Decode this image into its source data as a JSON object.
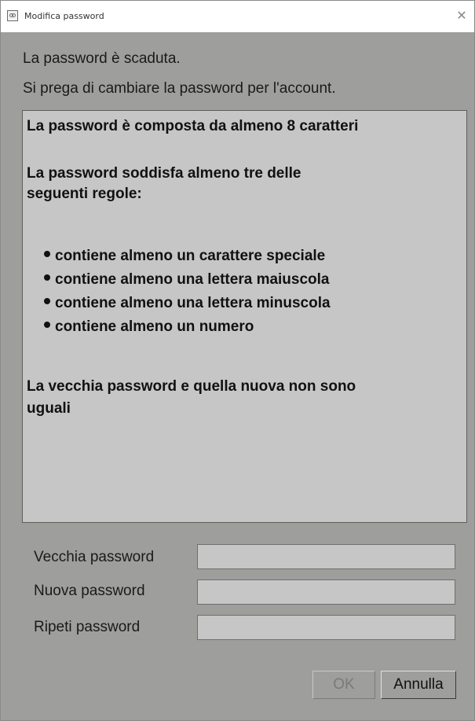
{
  "window": {
    "title": "Modifica password",
    "close_glyph": "✕"
  },
  "messages": {
    "expired": "La password è scaduta.",
    "instruction": "Si prega di cambiare la password per l'account."
  },
  "rules": {
    "length": "La password è composta da almeno 8 caratteri",
    "three_rules_line1": "La password soddisfa almeno tre delle",
    "three_rules_line2": "seguenti regole:",
    "items": [
      "contiene almeno un carattere speciale",
      "contiene almeno una lettera maiuscola",
      "contiene almeno una lettera minuscola",
      "contiene almeno un numero"
    ],
    "not_equal_line1": "La vecchia password e quella nuova non sono",
    "not_equal_line2": "uguali"
  },
  "fields": {
    "old_label": "Vecchia password",
    "old_value": "",
    "new_label": "Nuova password",
    "new_value": "",
    "repeat_label": "Ripeti password",
    "repeat_value": ""
  },
  "buttons": {
    "ok": "OK",
    "cancel": "Annulla"
  },
  "icons": {
    "app": "app-icon",
    "close": "close-icon",
    "bullet": "bullet-dot-icon"
  },
  "colors": {
    "window_bg": "#9e9e9c",
    "panel_bg": "#c6c6c6",
    "disabled_text": "#7a7a7a"
  }
}
